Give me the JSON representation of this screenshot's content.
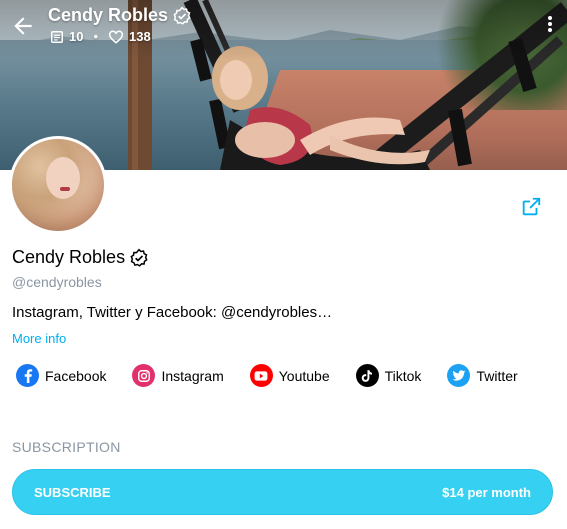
{
  "header": {
    "title": "Cendy Robles",
    "posts_count": "10",
    "likes_count": "138",
    "separator": "•"
  },
  "profile": {
    "name": "Cendy Robles",
    "handle": "@cendyrobles",
    "bio": "Instagram, Twitter y Facebook: @cendyrobles…",
    "more_info_label": "More info"
  },
  "socials": [
    {
      "label": "Facebook",
      "icon": "facebook-icon",
      "color": "#1877f2"
    },
    {
      "label": "Instagram",
      "icon": "instagram-icon",
      "color": "#e1306c"
    },
    {
      "label": "Youtube",
      "icon": "youtube-icon",
      "color": "#ff0000"
    },
    {
      "label": "Tiktok",
      "icon": "tiktok-icon",
      "color": "#000000"
    },
    {
      "label": "Twitter",
      "icon": "twitter-icon",
      "color": "#1da1f2"
    }
  ],
  "subscription": {
    "section_title": "SUBSCRIPTION",
    "button_label": "SUBSCRIBE",
    "price": "$14 per month"
  },
  "colors": {
    "accent": "#00aff0",
    "subscribe_bg": "#36d0f2",
    "muted_text": "#8a96a3"
  }
}
